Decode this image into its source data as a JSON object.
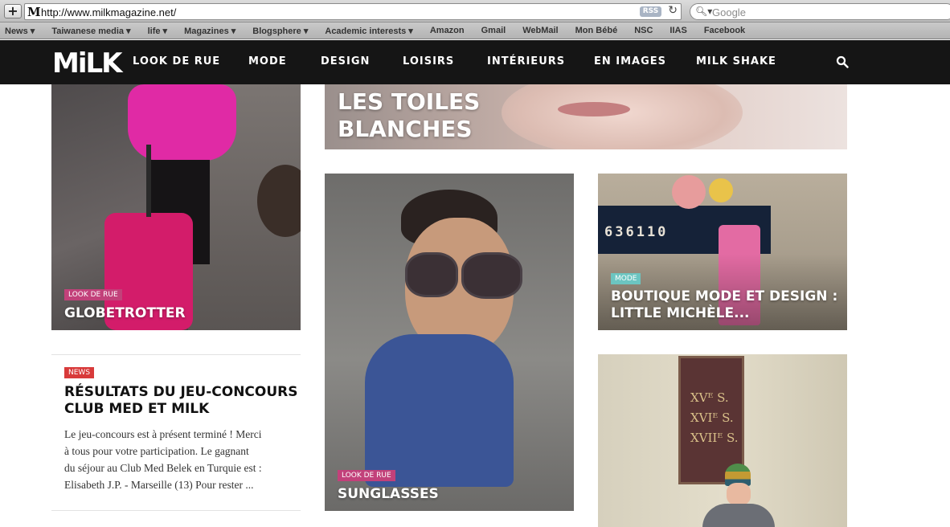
{
  "browser": {
    "url": "http://www.milkmagazine.net/",
    "rss_label": "RSS",
    "search_placeholder": "Google"
  },
  "bookmarks": [
    "News ▾",
    "Taiwanese media ▾",
    "life ▾",
    "Magazines ▾",
    "Blogsphere ▾",
    "Academic interests ▾",
    "Amazon",
    "Gmail",
    "WebMail",
    "Mon Bébé",
    "NSC",
    "IIAS",
    "Facebook"
  ],
  "site": {
    "logo": "MiLK",
    "nav": [
      "LOOK DE RUE",
      "MODE",
      "DESIGN",
      "LOISIRS",
      "INTÉRIEURS",
      "EN IMAGES",
      "MILK SHAKE"
    ]
  },
  "hero": {
    "title_line1": "LES TOILES",
    "title_line2": "BLANCHES"
  },
  "cards": {
    "globetrotter": {
      "tag": "LOOK DE RUE",
      "title": "GLOBETROTTER"
    },
    "sunglasses": {
      "tag": "LOOK DE RUE",
      "title": "SUNGLASSES"
    },
    "boutique": {
      "tag": "MODE",
      "title_line1": "BOUTIQUE MODE ET DESIGN :",
      "title_line2": "LITTLE MICHÈLE..."
    },
    "news": {
      "tag": "NEWS",
      "title_line1": "RÉSULTATS DU JEU-CONCOURS",
      "title_line2": "CLUB MED ET MILK",
      "excerpt_lines": [
        "Le jeu-concours est à présent terminé ! Merci",
        "à tous pour votre participation. Le gagnant",
        "du séjour au Club Med Belek en Turquie est :",
        "Elisabeth J.P. - Marseille (13) Pour rester ..."
      ]
    },
    "plaque": {
      "line1": "XVᴱ S.",
      "line2": "XVIᴱ S.",
      "line3": "XVIIᴱ S."
    },
    "boat_number": "636110"
  },
  "colors": {
    "tag_pink": "#c2417a",
    "tag_teal": "#6cc5c1",
    "tag_red": "#d83a3a",
    "nav_bg": "#151515"
  }
}
